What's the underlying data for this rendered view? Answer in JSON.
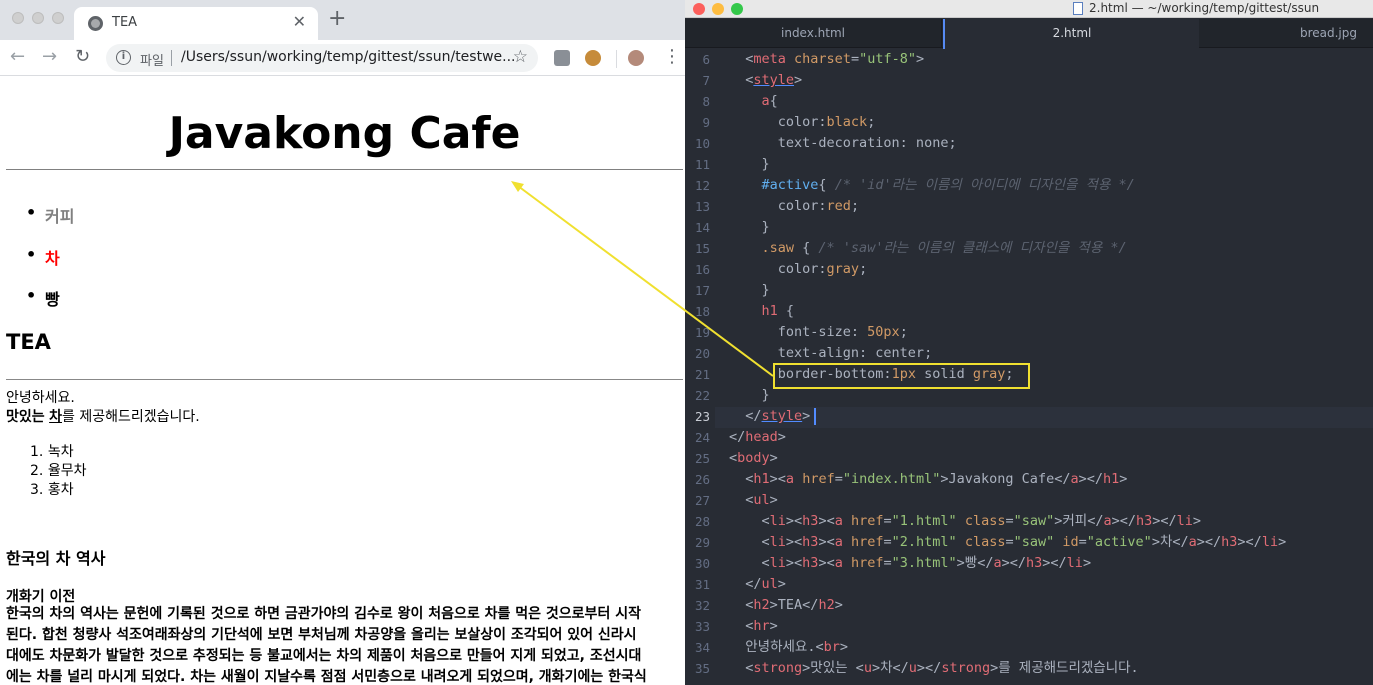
{
  "browser": {
    "tab_title": "TEA",
    "new_tab_label": "+",
    "tab_close_label": "✕",
    "omnibox_label": "파일",
    "url": "/Users/ssun/working/temp/gittest/ssun/testwe...",
    "info_label": "i",
    "star_label": "☆",
    "back_label": "←",
    "forward_label": "→",
    "reload_label": "↻",
    "menu_label": "⋮"
  },
  "page": {
    "heading": "Javakong Cafe",
    "nav": [
      "커피",
      "차",
      "빵"
    ],
    "nav_colors": [
      "#808080",
      "#ff0000",
      "#000000"
    ],
    "section_title": "TEA",
    "greeting": "안녕하세요.",
    "offer_strong": "맛있는",
    "offer_underline": "차",
    "offer_rest": "를 제공해드리겠습니다.",
    "tea_list": [
      "녹차",
      "율무차",
      "홍차"
    ],
    "history_title": "한국의 차 역사",
    "history_subtitle": "개화기 이전",
    "history_body": "한국의 차의 역사는 문헌에 기록된 것으로 하면 금관가야의 김수로 왕이 처음으로 차를 먹은 것으로부터 시작\n된다. 합천 청량사 석조여래좌상의 기단석에 보면 부처님께 차공양을 올리는 보살상이 조각되어 있어 신라시\n대에도 차문화가 발달한 것으로 추정되는 등 불교에서는 차의 제품이 처음으로 만들어 지게 되었고, 조선시대\n에는 차를 널리 마시게 되었다. 차는 새월이 지날수록 점점 서민층으로 내려오게 되었으며, 개화기에는 한국식\n차를 그램의라 가치, 우리 프레 이후에 가장적 성처하며 재현형 하추 이행진자로 진시적 함증네는 가치"
  },
  "editor": {
    "window_title": "2.html — ~/working/temp/gittest/ssun",
    "tabs": [
      "index.html",
      "2.html",
      "bread.jpg"
    ],
    "active_tab": "2.html",
    "line_numbers": [
      "6",
      "7",
      "8",
      "9",
      "10",
      "11",
      "12",
      "13",
      "14",
      "15",
      "16",
      "17",
      "18",
      "19",
      "20",
      "21",
      "22",
      "23",
      "24",
      "25",
      "26",
      "27",
      "28",
      "29",
      "30",
      "31",
      "32",
      "33",
      "34",
      "35"
    ],
    "current_line": "23",
    "highlight_color": "#f0e030"
  }
}
